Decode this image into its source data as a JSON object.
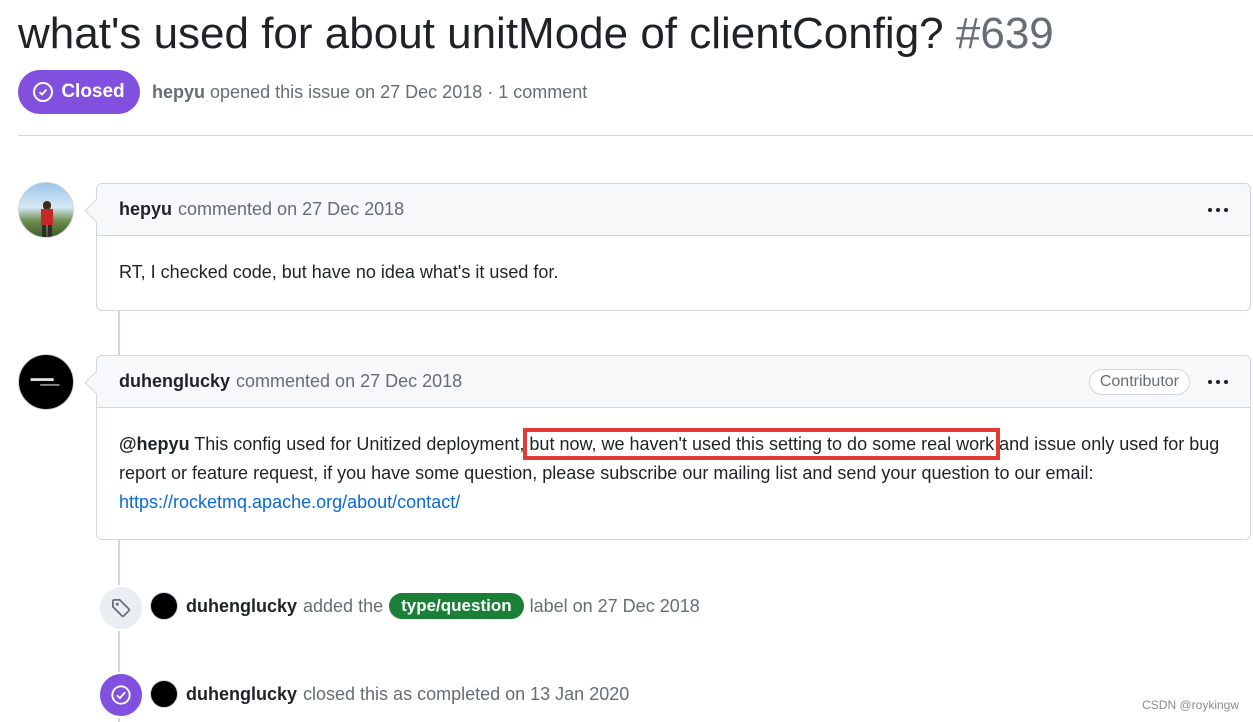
{
  "issue": {
    "title": "what's used for about unitMode of clientConfig?",
    "number": "#639",
    "state": "Closed",
    "author": "hepyu",
    "opened_text": "opened this issue on 27 Dec 2018 · 1 comment"
  },
  "comments": [
    {
      "author": "hepyu",
      "action": "commented on 27 Dec 2018",
      "body": "RT, I checked code, but have no idea what's it used for."
    },
    {
      "author": "duhenglucky",
      "action": "commented on 27 Dec 2018",
      "badge": "Contributor",
      "mention": "@hepyu",
      "body_part1": " This config used for Unitized deployment, ",
      "body_highlight": "but now, we haven't used this setting to do some real work",
      "body_part2": " and issue only used for bug report or feature request, if you have some question, please subscribe our mailing list and send your question to our email: ",
      "link": "https://rocketmq.apache.org/about/contact/"
    }
  ],
  "events": [
    {
      "actor": "duhenglucky",
      "text_before": "added the",
      "label": "type/question",
      "text_after": "label on 27 Dec 2018",
      "icon": "tag-icon",
      "label_color": "#1a7f37"
    },
    {
      "actor": "duhenglucky",
      "text": "closed this as completed on 13 Jan 2020",
      "icon": "issue-closed-icon"
    }
  ],
  "colors": {
    "closed_badge": "#8250df",
    "link": "#0969da",
    "highlight_box": "#e53935"
  },
  "watermark": "CSDN @roykingw"
}
